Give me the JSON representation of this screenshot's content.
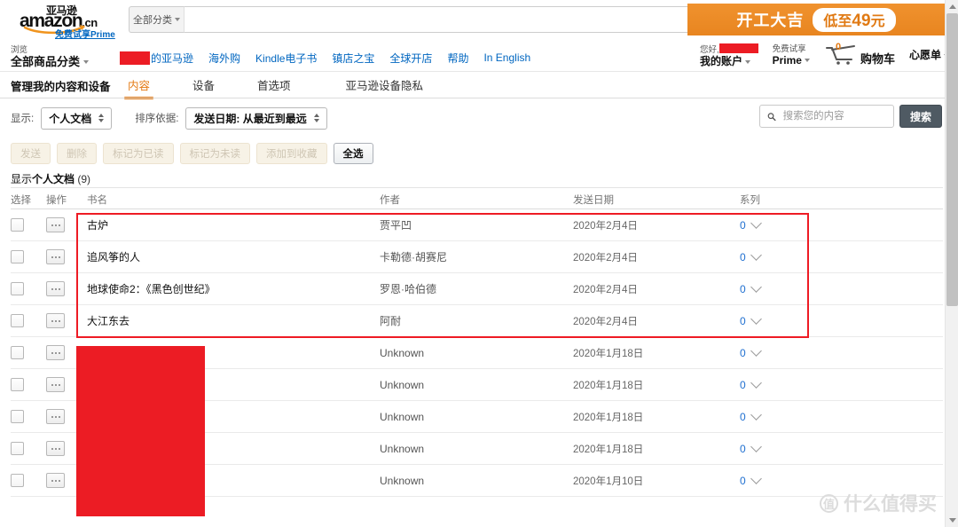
{
  "header": {
    "logo": {
      "cn_top": "亚马逊",
      "main": "amazon",
      "domain": ".cn",
      "prime_link": "免费试享Prime"
    },
    "search": {
      "category": "全部分类",
      "value": "",
      "placeholder": "",
      "icon": "search-icon"
    },
    "promo": {
      "title": "开工大吉",
      "pill_prefix": "低至",
      "pill_amount": "49",
      "pill_suffix": "元"
    },
    "account": {
      "greeting": "您好,",
      "name_redacted": "",
      "account_label": "我的账户",
      "prime_top": "免费试享",
      "prime_label": "Prime",
      "cart_count": "0",
      "cart_label": "购物车",
      "wishlist_label": "心愿单"
    },
    "nav": {
      "browse_top": "浏览",
      "browse_label": "全部商品分类",
      "links": [
        {
          "label": "的亚马逊",
          "redacted_prefix": true
        },
        {
          "label": "海外购"
        },
        {
          "label": "Kindle电子书"
        },
        {
          "label": "镇店之宝"
        },
        {
          "label": "全球开店"
        },
        {
          "label": "帮助"
        },
        {
          "label": "In English"
        }
      ]
    }
  },
  "page": {
    "title": "管理我的内容和设备",
    "tabs": [
      {
        "label": "内容",
        "active": true
      },
      {
        "label": "设备",
        "active": false
      },
      {
        "label": "首选项",
        "active": false
      },
      {
        "label": "亚马逊设备隐私",
        "active": false
      }
    ]
  },
  "filters": {
    "show_label": "显示:",
    "show_value": "个人文档",
    "sort_label": "排序依据:",
    "sort_value": "发送日期: 从最近到最远"
  },
  "content_search": {
    "placeholder": "搜索您的内容",
    "value": "",
    "button_label": "搜索",
    "icon": "search-icon"
  },
  "actions": [
    {
      "label": "发送",
      "enabled": false
    },
    {
      "label": "删除",
      "enabled": false
    },
    {
      "label": "标记为已读",
      "enabled": false
    },
    {
      "label": "标记为未读",
      "enabled": false
    },
    {
      "label": "添加到收藏",
      "enabled": false
    },
    {
      "label": "全选",
      "enabled": true
    }
  ],
  "list_summary": {
    "prefix": "显示",
    "type": "个人文档",
    "count": "(9)"
  },
  "table": {
    "columns": {
      "select": "选择",
      "action": "操作",
      "title": "书名",
      "author": "作者",
      "date": "发送日期",
      "series": "系列"
    },
    "rows": [
      {
        "title": "古炉",
        "author": "贾平凹",
        "date": "2020年2月4日",
        "series": "0",
        "highlighted": true,
        "redacted": false
      },
      {
        "title": "追风筝的人",
        "author": "卡勒德·胡赛尼",
        "date": "2020年2月4日",
        "series": "0",
        "highlighted": true,
        "redacted": false
      },
      {
        "title": "地球使命2：《黑色创世纪》",
        "author": "罗恩·哈伯德",
        "date": "2020年2月4日",
        "series": "0",
        "highlighted": true,
        "redacted": false
      },
      {
        "title": "大江东去",
        "author": "阿耐",
        "date": "2020年2月4日",
        "series": "0",
        "highlighted": true,
        "redacted": false
      },
      {
        "title": "",
        "author": "Unknown",
        "date": "2020年1月18日",
        "series": "0",
        "highlighted": false,
        "redacted": true
      },
      {
        "title": "",
        "author": "Unknown",
        "date": "2020年1月18日",
        "series": "0",
        "highlighted": false,
        "redacted": true
      },
      {
        "title": "",
        "author": "Unknown",
        "date": "2020年1月18日",
        "series": "0",
        "highlighted": false,
        "redacted": true
      },
      {
        "title": "",
        "author": "Unknown",
        "date": "2020年1月18日",
        "series": "0",
        "highlighted": false,
        "redacted": true
      },
      {
        "title": "",
        "author": "Unknown",
        "date": "2020年1月10日",
        "series": "0",
        "highlighted": false,
        "redacted": true
      }
    ]
  },
  "watermark": {
    "mark": "值",
    "text": "什么值得买"
  },
  "colors": {
    "accent_orange": "#e47911",
    "promo_orange": "#ea8a22",
    "link_blue": "#0066c0",
    "series_blue": "#1f6fd0",
    "annotation_red": "#ec1c24"
  }
}
